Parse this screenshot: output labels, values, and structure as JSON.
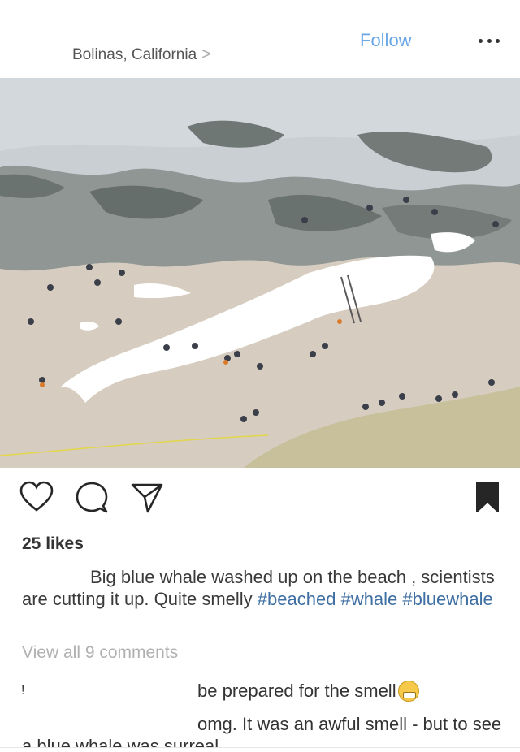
{
  "header": {
    "location": "Bolinas, California",
    "location_chevron": ">",
    "follow_label": "Follow",
    "more_icon": "more-horizontal-icon"
  },
  "post": {
    "image_subject": "beached whale on sandy shore with people",
    "actions": {
      "like_icon": "heart-icon",
      "comment_icon": "comment-bubble-icon",
      "share_icon": "paper-plane-icon",
      "save_icon": "bookmark-icon"
    },
    "likes": "25 likes",
    "caption": {
      "text": "Big blue whale washed up on the beach , scientists are cutting it up. Quite smelly ",
      "tags": [
        "#beached",
        "#whale",
        "#bluewhale"
      ]
    },
    "view_comments": "View all 9 comments",
    "comments": [
      {
        "user": "!",
        "text": "be prepared for the smell"
      },
      {
        "user": "",
        "text": "omg. It was an awful smell - but to see a blue whale was surreal"
      }
    ]
  },
  "colors": {
    "follow": "#6aa7e6",
    "hashtag": "#3f6fa3",
    "muted": "#b0b0b0"
  }
}
